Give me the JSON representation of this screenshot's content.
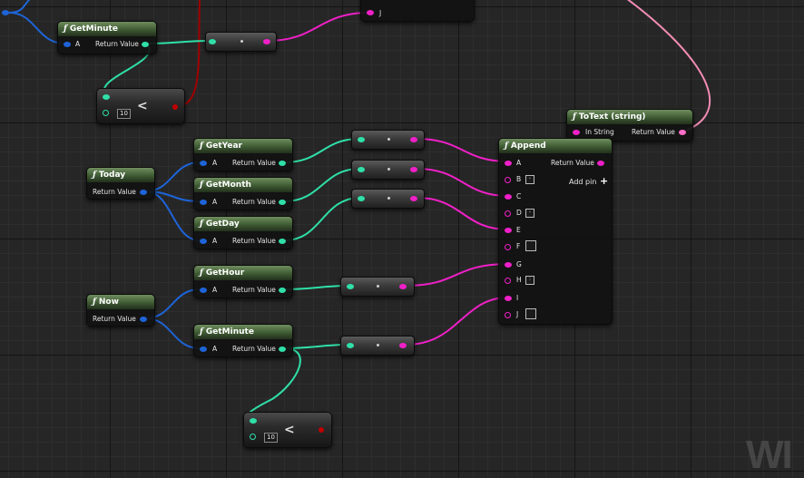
{
  "colors": {
    "exec_wire": "#f020c8",
    "float_wire": "#2fe0a8",
    "struct_wire": "#1e64d8",
    "bool_wire": "#a00000",
    "text_wire": "#f28cb4"
  },
  "nodes": {
    "get_minute_top": {
      "title": "GetMinute",
      "in_label": "A",
      "out_label": "Return Value"
    },
    "compare_top": {
      "value": "10",
      "op": "<"
    },
    "concat_top": {
      "label": "J"
    },
    "totext": {
      "title": "ToText (string)",
      "in_label": "In String",
      "out_label": "Return Value"
    },
    "get_year": {
      "title": "GetYear",
      "in_label": "A",
      "out_label": "Return Value"
    },
    "get_month": {
      "title": "GetMonth",
      "in_label": "A",
      "out_label": "Return Value"
    },
    "get_day": {
      "title": "GetDay",
      "in_label": "A",
      "out_label": "Return Value"
    },
    "today": {
      "title": "Today",
      "out_label": "Return Value"
    },
    "get_hour": {
      "title": "GetHour",
      "in_label": "A",
      "out_label": "Return Value"
    },
    "now": {
      "title": "Now",
      "out_label": "Return Value"
    },
    "get_minute": {
      "title": "GetMinute",
      "in_label": "A",
      "out_label": "Return Value"
    },
    "compare_bottom": {
      "value": "10",
      "op": "<"
    },
    "append": {
      "title": "Append",
      "out_label": "Return Value",
      "add_pin": "Add pin",
      "pins": [
        "A",
        "B",
        "C",
        "D",
        "E",
        "F",
        "G",
        "H",
        "I",
        "J"
      ],
      "pin_defaults": {
        "B": "-",
        "D": "-",
        "H": ":"
      }
    }
  },
  "watermark": "WI"
}
